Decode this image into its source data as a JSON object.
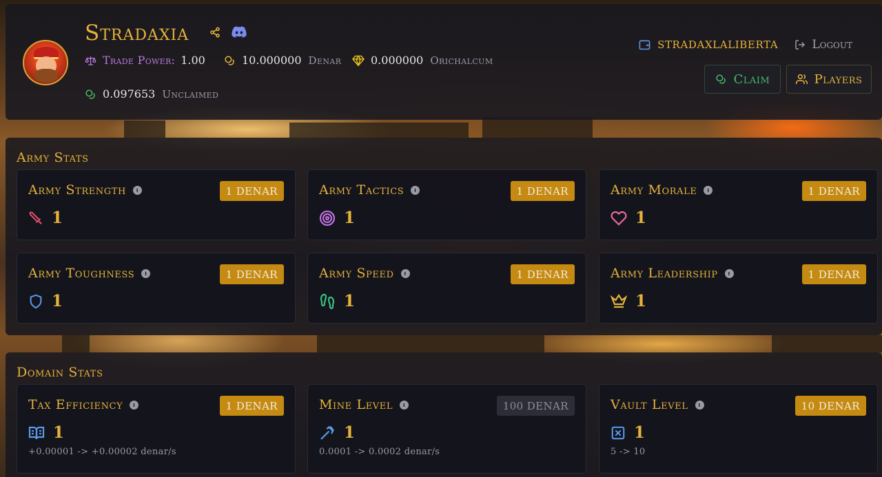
{
  "header": {
    "title": "Stradaxia",
    "trade_power_label": "Trade Power:",
    "trade_power_value": "1.00",
    "denar_value": "10.000000",
    "denar_label": "Denar",
    "orichalcum_value": "0.000000",
    "orichalcum_label": "Orichalcum",
    "unclaimed_value": "0.097653",
    "unclaimed_label": "Unclaimed",
    "username": "STRADAXLALIBERTA",
    "logout_label": "Logout",
    "claim_label": "Claim",
    "players_label": "Players"
  },
  "army": {
    "section_title": "Army Stats",
    "cards": [
      {
        "name": "Army Strength",
        "cost": "1 DENAR",
        "level": "1",
        "icon": "sword-icon",
        "color": "#e0506a"
      },
      {
        "name": "Army Tactics",
        "cost": "1 DENAR",
        "level": "1",
        "icon": "target-icon",
        "color": "#c070e0"
      },
      {
        "name": "Army Morale",
        "cost": "1 DENAR",
        "level": "1",
        "icon": "heart-icon",
        "color": "#e86a9a"
      },
      {
        "name": "Army Toughness",
        "cost": "1 DENAR",
        "level": "1",
        "icon": "shield-icon",
        "color": "#5a9ae8"
      },
      {
        "name": "Army Speed",
        "cost": "1 DENAR",
        "level": "1",
        "icon": "footprints-icon",
        "color": "#3ac080"
      },
      {
        "name": "Army Leadership",
        "cost": "1 DENAR",
        "level": "1",
        "icon": "crown-icon",
        "color": "#e6b33a"
      }
    ]
  },
  "domain": {
    "section_title": "Domain Stats",
    "cards": [
      {
        "name": "Tax Efficiency",
        "cost": "1 DENAR",
        "level": "1",
        "rate": "+0.00001 -> +0.00002 denar/s",
        "icon": "book-icon",
        "color": "#5a9ae8"
      },
      {
        "name": "Mine Level",
        "cost": "100 DENAR",
        "level": "1",
        "rate": "0.0001 -> 0.0002 denar/s",
        "icon": "pickaxe-icon",
        "color": "#5a9ae8"
      },
      {
        "name": "Vault Level",
        "cost": "10 DENAR",
        "level": "1",
        "rate": "5 -> 10",
        "icon": "vault-icon",
        "color": "#5a9ae8"
      }
    ]
  }
}
